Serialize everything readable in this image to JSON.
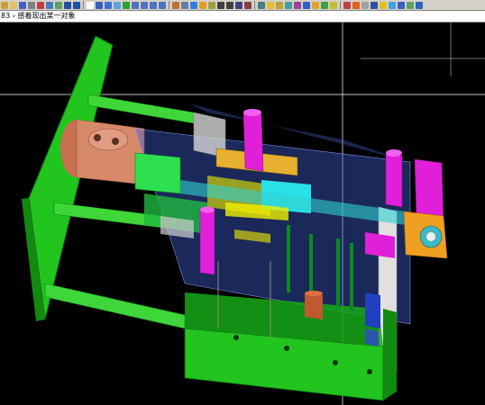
{
  "app": {
    "prompt_text": "83 › 感着现出某一对象"
  },
  "toolbar": {
    "icons": [
      "new-icon",
      "open-icon",
      "save-icon",
      "print-icon",
      "cut-icon",
      "copy-icon",
      "paste-icon",
      "undo-icon",
      "redo-icon",
      "select-icon",
      "window-icon",
      "zoom-icon",
      "pan-icon",
      "rotate-icon",
      "view-top-icon",
      "view-front-icon",
      "view-side-icon",
      "view-iso-icon",
      "shade-icon",
      "wireframe-icon",
      "sphere-icon",
      "snap-icon",
      "layer-icon",
      "point-icon",
      "line-icon",
      "arc-icon",
      "circle-icon",
      "spline-icon",
      "surface-icon",
      "solid-icon",
      "measure-icon",
      "analyze-icon",
      "transform-icon",
      "mirror-icon",
      "array-icon",
      "trim-icon",
      "extend-icon",
      "fillet-icon",
      "chamfer-icon",
      "drill-icon",
      "toolpath-icon",
      "simulate-icon",
      "verify-icon",
      "post-icon",
      "help-icon"
    ],
    "icon_colors": [
      "#c8a040",
      "#e0c060",
      "#4060c0",
      "#808080",
      "#c04040",
      "#4080c0",
      "#60a060",
      "#2050a0",
      "#2050a0",
      "#ffffff",
      "#3060c0",
      "#4070d0",
      "#60a0e0",
      "#30a030",
      "#5070c0",
      "#5070c0",
      "#5070c0",
      "#5070c0",
      "#c07030",
      "#6080a0",
      "#3080e0",
      "#e0a020",
      "#a0a040",
      "#404040",
      "#404040",
      "#404080",
      "#804040",
      "#408080",
      "#e0c030",
      "#c0a030",
      "#40a0a0",
      "#a040a0",
      "#3060c0",
      "#e0a030",
      "#40a040",
      "#c0c030",
      "#c04040",
      "#e06020",
      "#a0a0a0",
      "#3050a0",
      "#e0c020",
      "#40a0e0",
      "#4060c0",
      "#60a060",
      "#3060c0"
    ]
  },
  "scene": {
    "background": "#000000",
    "crosshair_color": "#ffffff",
    "component_colors": {
      "base_plate": "#22c41e",
      "frame": "#14a010",
      "tie_bar": "#3fd63a",
      "cylinder": "#d68a6a",
      "mold_body": "#3b5cc8",
      "magenta_parts": "#e020d8",
      "cyan_parts": "#28e0e8",
      "orange_gear": "#f0a020",
      "grey_slide": "#d8d8d8",
      "yellow_insert": "#f0f000",
      "red_pin": "#e83020",
      "dark_green": "#0a8a20"
    }
  }
}
